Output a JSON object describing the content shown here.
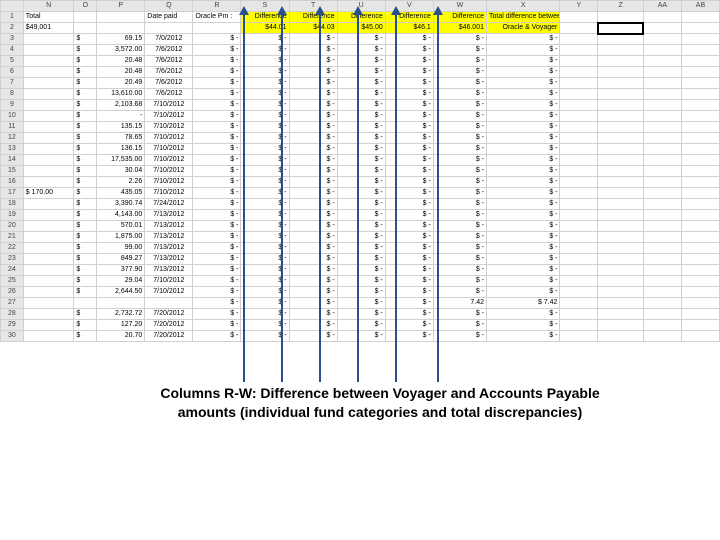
{
  "columns": [
    "",
    "N",
    "O",
    "P",
    "Q",
    "R",
    "S",
    "T",
    "U",
    "V",
    "W",
    "X",
    "Y",
    "Z",
    "AA",
    "AB"
  ],
  "header1": {
    "N": "Total",
    "Q": "Date paid",
    "R": "Oracle Pm :",
    "S": "Difference",
    "T": "Difference",
    "U": "Difference",
    "V": "Difference",
    "W": "Difference",
    "X": "Total difference between"
  },
  "header2": {
    "N": "$49,001",
    "S": "$44.01",
    "T": "$44.03",
    "U": "$45.00",
    "V": "$46.1",
    "W": "$46.001",
    "X": "Oracle & Voyager"
  },
  "caption": "Columns R-W: Difference between Voyager and Accounts Payable amounts (individual fund categories and total discrepancies)",
  "rows": [
    {
      "n": 3,
      "O": "$",
      "P": "69.15",
      "Q": "7/0/2012"
    },
    {
      "n": 4,
      "O": "$",
      "P": "3,572.00",
      "Q": "7/6/2012"
    },
    {
      "n": 5,
      "O": "$",
      "P": "20.48",
      "Q": "7/6/2012"
    },
    {
      "n": 6,
      "O": "$",
      "P": "20.48",
      "Q": "7/6/2012"
    },
    {
      "n": 7,
      "O": "$",
      "P": "20.49",
      "Q": "7/6/2012"
    },
    {
      "n": 8,
      "O": "$",
      "P": "13,610.00",
      "Q": "7/6/2012"
    },
    {
      "n": 9,
      "O": "$",
      "P": "2,103.68",
      "Q": "7/10/2012"
    },
    {
      "n": 10,
      "O": "$",
      "P": "-",
      "Q": "7/10/2012"
    },
    {
      "n": 11,
      "O": "$",
      "P": "135.15",
      "Q": "7/10/2012"
    },
    {
      "n": 12,
      "O": "$",
      "P": "78.65",
      "Q": "7/10/2012"
    },
    {
      "n": 13,
      "O": "$",
      "P": "136.15",
      "Q": "7/10/2012"
    },
    {
      "n": 14,
      "O": "$",
      "P": "17,535.00",
      "Q": "7/10/2012"
    },
    {
      "n": 15,
      "O": "$",
      "P": "30.04",
      "Q": "7/10/2012"
    },
    {
      "n": 16,
      "O": "$",
      "P": "2.26",
      "Q": "7/10/2012"
    },
    {
      "n": 17,
      "N": "$     170.00",
      "O": "$",
      "P": "435.05",
      "Q": "7/10/2012"
    },
    {
      "n": 18,
      "O": "$",
      "P": "3,390.74",
      "Q": "7/24/2012"
    },
    {
      "n": 19,
      "O": "$",
      "P": "4,143.00",
      "Q": "7/13/2012"
    },
    {
      "n": 20,
      "O": "$",
      "P": "570.01",
      "Q": "7/13/2012"
    },
    {
      "n": 21,
      "O": "$",
      "P": "1,875.00",
      "Q": "7/13/2012"
    },
    {
      "n": 22,
      "O": "$",
      "P": "99.00",
      "Q": "7/13/2012"
    },
    {
      "n": 23,
      "O": "$",
      "P": "849.27",
      "Q": "7/13/2012"
    },
    {
      "n": 24,
      "O": "$",
      "P": "377.90",
      "Q": "7/13/2012"
    },
    {
      "n": 25,
      "O": "$",
      "P": "29.04",
      "Q": "7/10/2012"
    },
    {
      "n": 26,
      "O": "$",
      "P": "2,644.50",
      "Q": "7/10/2012"
    },
    {
      "n": 27,
      "O": "",
      "P": "",
      "Q": "",
      "W": "7.42",
      "X": "$        7.42"
    },
    {
      "n": 28,
      "O": "$",
      "P": "2,732.72",
      "Q": "7/20/2012"
    },
    {
      "n": 29,
      "O": "$",
      "P": "127.20",
      "Q": "7/20/2012"
    },
    {
      "n": 30,
      "O": "$",
      "P": "20.70",
      "Q": "7/20/2012"
    }
  ],
  "diff_prefix": "$",
  "diff_value": "-",
  "arrows_x": [
    243,
    281,
    319,
    357,
    395,
    437
  ]
}
